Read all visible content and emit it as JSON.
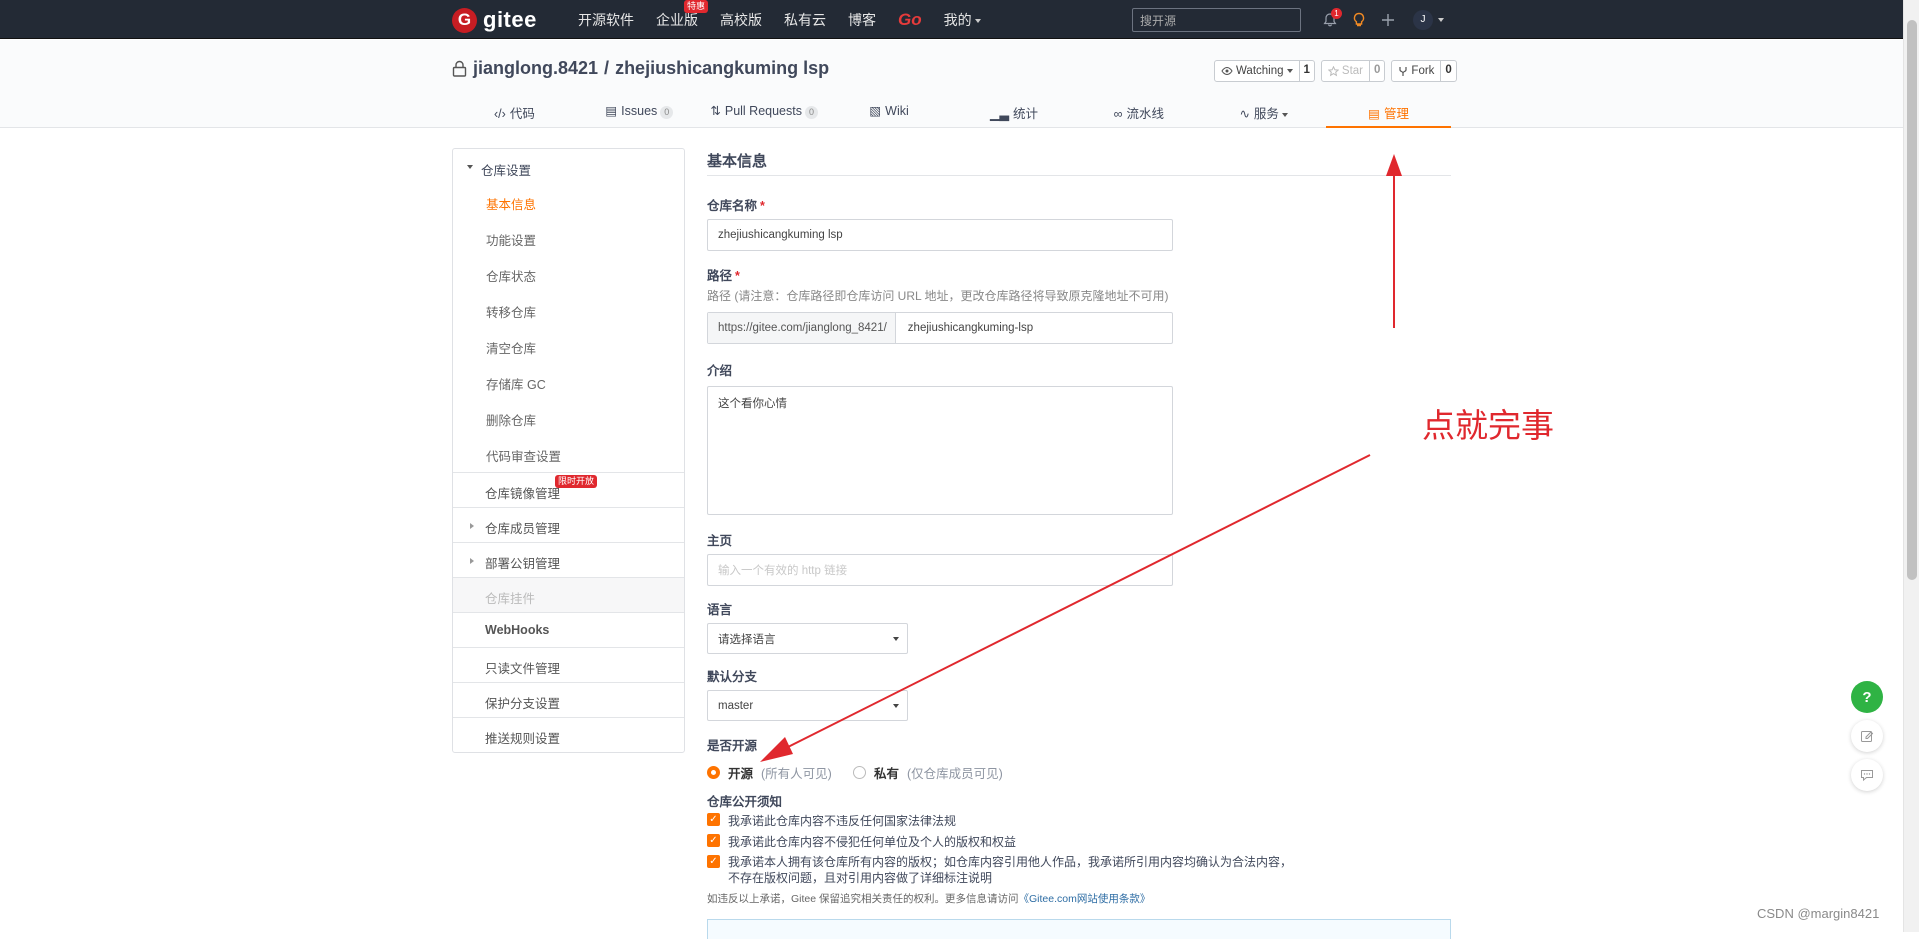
{
  "topnav": {
    "logo_letter": "G",
    "logo_text": "gitee",
    "items": [
      "开源软件",
      "企业版",
      "高校版",
      "私有云",
      "博客",
      "Go",
      "我的"
    ],
    "enterprise_badge": "特惠",
    "search_placeholder": "搜开源",
    "notif_count": "1",
    "avatar_letter": "J"
  },
  "repo": {
    "owner": "jianglong.8421",
    "separator": "/",
    "name": "zhejiushicangkuming lsp",
    "watch_label": "Watching",
    "watch_count": "1",
    "star_label": "Star",
    "star_count": "0",
    "fork_label": "Fork",
    "fork_count": "0"
  },
  "tabs": [
    {
      "label": "代码",
      "icon": "code-icon"
    },
    {
      "label": "Issues",
      "count": "0",
      "icon": "issues-icon"
    },
    {
      "label": "Pull Requests",
      "count": "0",
      "icon": "pull-request-icon"
    },
    {
      "label": "Wiki",
      "icon": "wiki-icon"
    },
    {
      "label": "统计",
      "icon": "stats-icon"
    },
    {
      "label": "流水线",
      "icon": "pipeline-icon"
    },
    {
      "label": "服务",
      "icon": "service-icon"
    },
    {
      "label": "管理",
      "icon": "manage-icon",
      "active": true
    }
  ],
  "sidebar": {
    "group_title": "仓库设置",
    "group_items": [
      "基本信息",
      "功能设置",
      "仓库状态",
      "转移仓库",
      "清空仓库",
      "存储库 GC",
      "删除仓库",
      "代码审查设置"
    ],
    "rows": [
      "仓库镜像管理",
      "仓库成员管理",
      "部署公钥管理",
      "仓库挂件",
      "WebHooks",
      "只读文件管理",
      "保护分支设置",
      "推送规则设置"
    ],
    "limited_badge": "限时开放"
  },
  "form": {
    "section_title": "基本信息",
    "name_label": "仓库名称",
    "required_mark": "*",
    "name_value": "zhejiushicangkuming   lsp",
    "path_label": "路径",
    "path_hint": "路径 (请注意：仓库路径即仓库访问 URL 地址，更改仓库路径将导致原克隆地址不可用)",
    "path_prefix": "https://gitee.com/jianglong_8421/",
    "path_value": "zhejiushicangkuming-lsp",
    "desc_label": "介绍",
    "desc_value": "这个看你心情",
    "homepage_label": "主页",
    "homepage_placeholder": "输入一个有效的 http 链接",
    "lang_label": "语言",
    "lang_value": "请选择语言",
    "branch_label": "默认分支",
    "branch_value": "master",
    "open_label": "是否开源",
    "open_option": "开源",
    "open_hint": "(所有人可见)",
    "private_option": "私有",
    "private_hint": "(仅仓库成员可见)",
    "notice_label": "仓库公开须知",
    "checks": [
      "我承诺此仓库内容不违反任何国家法律法规",
      "我承诺此仓库内容不侵犯任何单位及个人的版权和权益",
      "我承诺本人拥有该仓库所有内容的版权；如仓库内容引用他人作品，我承诺所引用内容均确认为合法内容，",
      "不存在版权问题，且对引用内容做了详细标注说明"
    ],
    "notice_text": "如违反以上承诺，Gitee 保留追究相关责任的权利。更多信息请访问",
    "notice_link": "《Gitee.com网站使用条款》"
  },
  "floats": {
    "help": "?"
  },
  "annotation": "点就完事",
  "watermark": "CSDN @margin8421",
  "colors": {
    "accent": "#fe7300",
    "nav_bg": "#232a35",
    "annotation": "#e0282e"
  }
}
